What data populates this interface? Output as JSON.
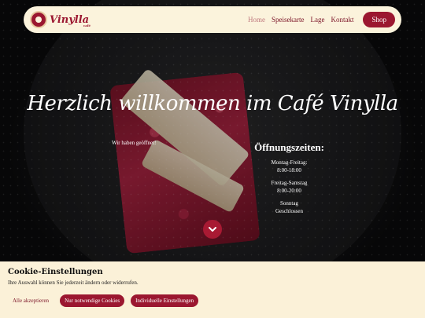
{
  "brand": {
    "name": "Vinylla",
    "sub": "café"
  },
  "nav": {
    "items": [
      {
        "label": "Home"
      },
      {
        "label": "Speisekarte"
      },
      {
        "label": "Lage"
      },
      {
        "label": "Kontakt"
      }
    ],
    "shop_label": "Shop"
  },
  "hero": {
    "title": "Herzlich willkommen im Café Vinylla",
    "open_note": "Wir haben geöffnet!",
    "hours_title": "Öffnungszeiten:",
    "hours": [
      {
        "days": "Montag-Freitag:",
        "time": "8:00-18:00"
      },
      {
        "days": "Freitag-Samstag",
        "time": "8:00-20:00"
      },
      {
        "days": "Sonntag",
        "time": "Geschlossen"
      }
    ]
  },
  "cookie": {
    "title": "Cookie-Einstellungen",
    "text": "Ihre Auswahl können Sie jederzeit ändern oder widerrufen.",
    "accept_all": "Alle akzeptieren",
    "necessary_only": "Nur notwendige Cookies",
    "individual": "Individuelle Einstellungen"
  },
  "colors": {
    "brand": "#9b1730",
    "cream": "#fbf3dc"
  },
  "icons": {
    "scroll": "chevron-down-icon"
  }
}
